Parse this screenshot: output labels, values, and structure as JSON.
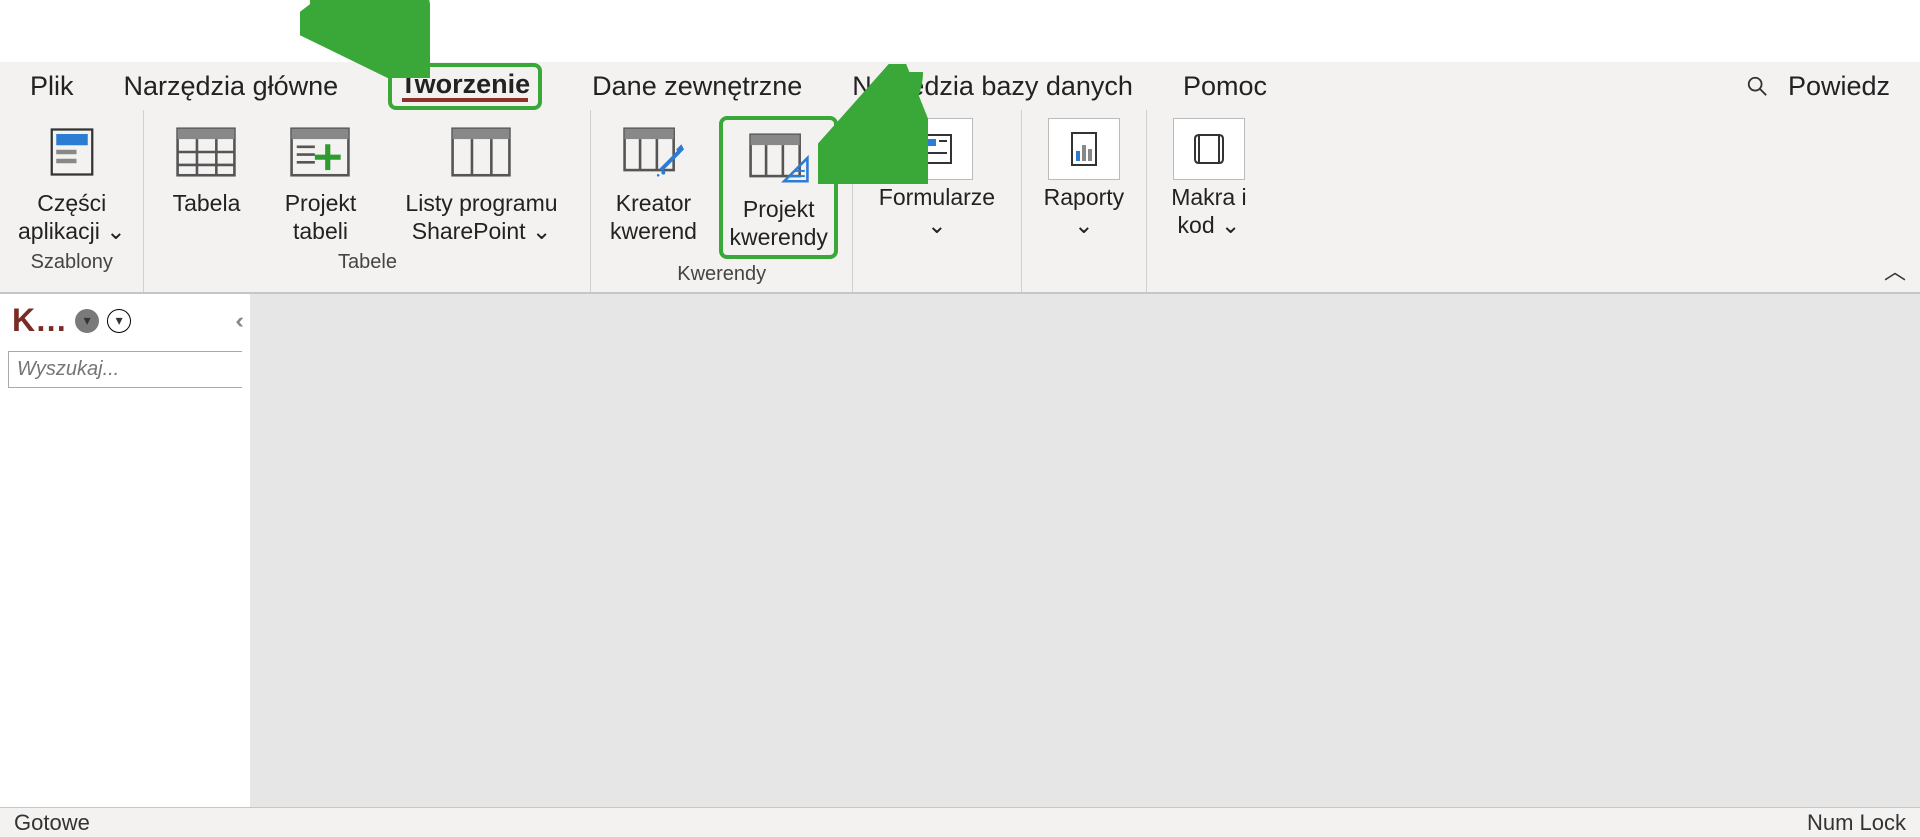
{
  "tabs": {
    "file": "Plik",
    "home": "Narzędzia główne",
    "create": "Tworzenie",
    "external": "Dane zewnętrzne",
    "dbtools": "Narzędzia bazy danych",
    "help": "Pomoc",
    "tellme": "Powiedz"
  },
  "groups": {
    "templates": {
      "label": "Szablony",
      "app_parts": "Części\naplikacji ⌄"
    },
    "tables": {
      "label": "Tabele",
      "table": "Tabela",
      "table_design": "Projekt\ntabeli",
      "sharepoint": "Listy programu\nSharePoint ⌄"
    },
    "queries": {
      "label": "Kwerendy",
      "wizard": "Kreator\nkwerend",
      "design": "Projekt\nkwerendy"
    },
    "forms": {
      "label": "Formularze",
      "forms": "Formularze\n⌄"
    },
    "reports": {
      "label": "Raporty",
      "reports": "Raporty\n⌄"
    },
    "macros": {
      "label": "Makra i kod",
      "macros": "Makra i\nkod ⌄"
    }
  },
  "nav": {
    "title": "K…",
    "search_placeholder": "Wyszukaj..."
  },
  "status": {
    "left": "Gotowe",
    "right": "Num Lock"
  }
}
